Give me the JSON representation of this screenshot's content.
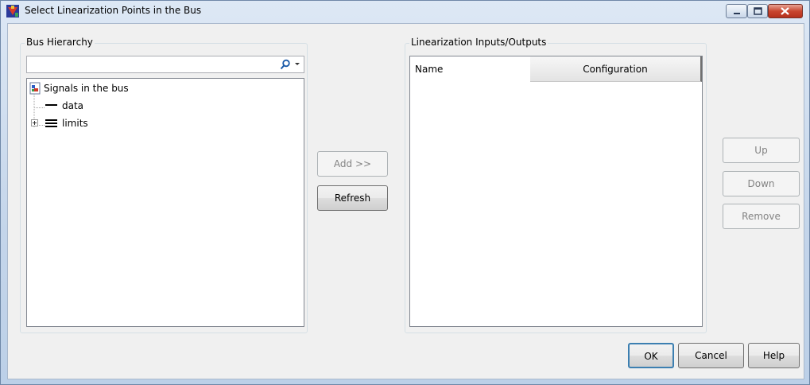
{
  "window": {
    "title": "Select Linearization Points in the Bus"
  },
  "bus_hierarchy": {
    "label": "Bus Hierarchy",
    "search_value": "",
    "tree": {
      "root": "Signals in the bus",
      "items": [
        {
          "label": "data",
          "expandable": false
        },
        {
          "label": "limits",
          "expandable": true
        }
      ]
    }
  },
  "middle_buttons": {
    "add": "Add >>",
    "refresh": "Refresh"
  },
  "linearization": {
    "label": "Linearization Inputs/Outputs",
    "columns": [
      "Name",
      "Configuration"
    ]
  },
  "side_buttons": {
    "up": "Up",
    "down": "Down",
    "remove": "Remove"
  },
  "footer": {
    "ok": "OK",
    "cancel": "Cancel",
    "help": "Help"
  }
}
